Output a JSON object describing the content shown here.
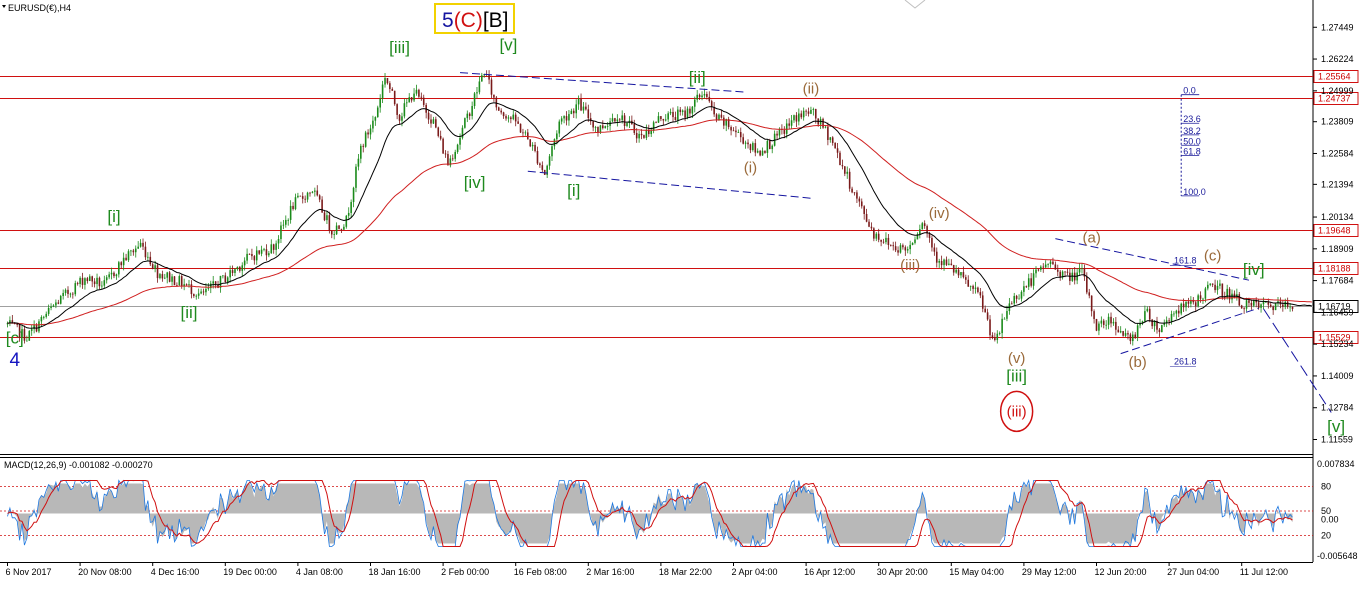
{
  "chart_data": {
    "type": "line",
    "title": "EURUSD(€),H4",
    "symbol_label": "EURUSD(€),H4",
    "wave_label_main": {
      "num": "5",
      "paren": "(C)",
      "bracket": "[B]",
      "colors": {
        "num": "#1515a0",
        "paren": "#d01010",
        "bracket": "#000000",
        "box": "#f2d200"
      }
    },
    "ylim": [
      1.11,
      1.285
    ],
    "y_ticks": [
      1.27449,
      1.26224,
      1.24999,
      1.23809,
      1.22584,
      1.21394,
      1.20134,
      1.18909,
      1.17684,
      1.16459,
      1.15234,
      1.14009,
      1.12784,
      1.11559
    ],
    "y_tick_labels": [
      "1.27449",
      "1.26224",
      "1.24999",
      "1.23809",
      "1.22584",
      "1.21394",
      "1.20134",
      "1.18909",
      "1.17684",
      "1.16459",
      "1.15234",
      "1.14009",
      "1.12784",
      "1.11559"
    ],
    "x_tick_labels": [
      "6 Nov 2017",
      "20 Nov 08:00",
      "4 Dec 16:00",
      "19 Dec 00:00",
      "4 Jan 08:00",
      "18 Jan 16:00",
      "2 Feb 00:00",
      "16 Feb 08:00",
      "2 Mar 16:00",
      "18 Mar 22:00",
      "2 Apr 04:00",
      "16 Apr 12:00",
      "30 Apr 20:00",
      "15 May 04:00",
      "29 May 12:00",
      "12 Jun 20:00",
      "27 Jun 04:00",
      "11 Jul 12:00"
    ],
    "x_tick_idx": [
      0,
      30,
      60,
      90,
      120,
      150,
      180,
      210,
      240,
      270,
      300,
      330,
      360,
      390,
      420,
      450,
      480,
      510
    ],
    "n_bars": 540,
    "price_waypoints": [
      [
        0,
        1.16
      ],
      [
        8,
        1.155
      ],
      [
        20,
        1.168
      ],
      [
        32,
        1.178
      ],
      [
        40,
        1.175
      ],
      [
        48,
        1.185
      ],
      [
        55,
        1.191
      ],
      [
        62,
        1.18
      ],
      [
        72,
        1.176
      ],
      [
        80,
        1.171
      ],
      [
        90,
        1.178
      ],
      [
        100,
        1.186
      ],
      [
        110,
        1.19
      ],
      [
        118,
        1.206
      ],
      [
        126,
        1.212
      ],
      [
        134,
        1.196
      ],
      [
        140,
        1.2
      ],
      [
        146,
        1.228
      ],
      [
        152,
        1.24
      ],
      [
        156,
        1.256
      ],
      [
        162,
        1.24
      ],
      [
        168,
        1.25
      ],
      [
        176,
        1.238
      ],
      [
        182,
        1.222
      ],
      [
        186,
        1.23
      ],
      [
        192,
        1.245
      ],
      [
        197,
        1.258
      ],
      [
        202,
        1.244
      ],
      [
        210,
        1.238
      ],
      [
        216,
        1.23
      ],
      [
        222,
        1.218
      ],
      [
        228,
        1.238
      ],
      [
        236,
        1.245
      ],
      [
        244,
        1.235
      ],
      [
        252,
        1.241
      ],
      [
        262,
        1.232
      ],
      [
        270,
        1.24
      ],
      [
        280,
        1.241
      ],
      [
        288,
        1.25
      ],
      [
        292,
        1.24
      ],
      [
        300,
        1.235
      ],
      [
        310,
        1.226
      ],
      [
        318,
        1.232
      ],
      [
        326,
        1.24
      ],
      [
        332,
        1.242
      ],
      [
        340,
        1.232
      ],
      [
        350,
        1.21
      ],
      [
        358,
        1.195
      ],
      [
        366,
        1.19
      ],
      [
        372,
        1.189
      ],
      [
        378,
        1.2
      ],
      [
        384,
        1.186
      ],
      [
        392,
        1.18
      ],
      [
        402,
        1.17
      ],
      [
        408,
        1.152
      ],
      [
        414,
        1.168
      ],
      [
        420,
        1.174
      ],
      [
        430,
        1.184
      ],
      [
        438,
        1.178
      ],
      [
        444,
        1.18
      ],
      [
        450,
        1.159
      ],
      [
        456,
        1.162
      ],
      [
        464,
        1.153
      ],
      [
        470,
        1.165
      ],
      [
        476,
        1.158
      ],
      [
        482,
        1.165
      ],
      [
        490,
        1.168
      ],
      [
        498,
        1.175
      ],
      [
        504,
        1.172
      ],
      [
        512,
        1.167
      ]
    ],
    "series": [
      {
        "kind": "price",
        "color": "#1a8a1a"
      },
      {
        "kind": "moving-average",
        "color": "#000000",
        "period": 20
      },
      {
        "kind": "moving-average",
        "color": "#d02020",
        "period": 80
      }
    ],
    "horizontal_levels": [
      {
        "value": 1.25564,
        "label": "1.25564"
      },
      {
        "value": 1.24737,
        "label": "1.24737"
      },
      {
        "value": 1.19648,
        "label": "1.19648"
      },
      {
        "value": 1.18188,
        "label": "1.18188"
      },
      {
        "value": 1.15529,
        "label": "1.15529"
      }
    ],
    "current_price": {
      "value": 1.16719,
      "label": "1.16719"
    },
    "trendlines": [
      {
        "from": [
          187,
          1.257
        ],
        "to": [
          305,
          1.2495
        ]
      },
      {
        "from": [
          215,
          1.219
        ],
        "to": [
          333,
          1.2085
        ]
      },
      {
        "from": [
          433,
          1.193
        ],
        "to": [
          513,
          1.177
        ]
      },
      {
        "from": [
          460,
          1.1487
        ],
        "to": [
          517,
          1.1662
        ]
      }
    ],
    "projection": {
      "from": [
        519,
        1.166
      ],
      "to": [
        547,
        1.126
      ]
    },
    "fib_levels": {
      "x_idx": 485,
      "items": [
        {
          "label": "0.0",
          "value": 1.2485
        },
        {
          "label": "23.6",
          "value": 1.2375
        },
        {
          "label": "38.2",
          "value": 1.233
        },
        {
          "label": "50.0",
          "value": 1.229
        },
        {
          "label": "61.8",
          "value": 1.225
        },
        {
          "label": "100.0",
          "value": 1.2095
        }
      ],
      "extra": [
        {
          "label": "161.8",
          "x_idx": 482,
          "value": 1.1835
        },
        {
          "label": "261.8",
          "x_idx": 482,
          "value": 1.1445
        }
      ]
    },
    "wave_labels": [
      {
        "text": "[c]",
        "x_idx": 3,
        "value": 1.1525,
        "color": "green"
      },
      {
        "text": "4",
        "x_idx": 3,
        "value": 1.144,
        "color": "blue"
      },
      {
        "text": "[i]",
        "x_idx": 44,
        "value": 1.1995,
        "color": "green"
      },
      {
        "text": "[ii]",
        "x_idx": 75,
        "value": 1.1625,
        "color": "green"
      },
      {
        "text": "[iii]",
        "x_idx": 162,
        "value": 1.2645,
        "color": "green"
      },
      {
        "text": "[iv]",
        "x_idx": 193,
        "value": 1.2125,
        "color": "green"
      },
      {
        "text": "[v]",
        "x_idx": 207,
        "value": 1.2655,
        "color": "green"
      },
      {
        "text": "[i]",
        "x_idx": 234,
        "value": 1.2095,
        "color": "green"
      },
      {
        "text": "[ii]",
        "x_idx": 285,
        "value": 1.253,
        "color": "green"
      },
      {
        "text": "(i)",
        "x_idx": 307,
        "value": 1.2185,
        "color": "brown"
      },
      {
        "text": "(ii)",
        "x_idx": 332,
        "value": 1.249,
        "color": "brown"
      },
      {
        "text": "(iii)",
        "x_idx": 373,
        "value": 1.181,
        "color": "brown"
      },
      {
        "text": "(iv)",
        "x_idx": 385,
        "value": 1.201,
        "color": "brown"
      },
      {
        "text": "(v)",
        "x_idx": 417,
        "value": 1.145,
        "color": "brown"
      },
      {
        "text": "[iii]",
        "x_idx": 417,
        "value": 1.138,
        "color": "green"
      },
      {
        "text": "(a)",
        "x_idx": 448,
        "value": 1.1915,
        "color": "brown"
      },
      {
        "text": "(b)",
        "x_idx": 467,
        "value": 1.1435,
        "color": "brown"
      },
      {
        "text": "(c)",
        "x_idx": 498,
        "value": 1.1845,
        "color": "brown"
      },
      {
        "text": "[iv]",
        "x_idx": 515,
        "value": 1.179,
        "color": "green"
      },
      {
        "text": "[v]",
        "x_idx": 549,
        "value": 1.1185,
        "color": "green"
      }
    ],
    "circled_label": {
      "text": "(iii)",
      "x_idx": 417,
      "value": 1.1245,
      "color": "#d01010"
    },
    "macd": {
      "title": "MACD(12,26,9) -0.001082 -0.000270",
      "title_name": "MACD(12,26,9)",
      "title_values": "-0.001082 -0.000270",
      "axis_label": "0.007834",
      "axis_label_bottom": "-0.005648",
      "osc_levels": [
        80,
        50,
        20
      ],
      "osc_tick_labels": [
        "80",
        "50",
        "0.00",
        "20"
      ],
      "colors": {
        "histogram": "#b8b8b8",
        "signal": "#d01010",
        "oscillator": "#1e78e0",
        "levels": "#d01010"
      }
    },
    "colors": {
      "background": "#ffffff",
      "candle_up": "#1a8a1a",
      "candle_down": "#7a1a1a",
      "ma_fast": "#000000",
      "ma_slow": "#d02020",
      "level_line": "#d01010",
      "current_line": "#a0a0a0",
      "trendline": "#1515a0",
      "fib": "#1a1a9a",
      "wave_green": "#1f8a1f",
      "wave_brown": "#9a6a3a",
      "wave_blue": "#1515c0"
    }
  }
}
